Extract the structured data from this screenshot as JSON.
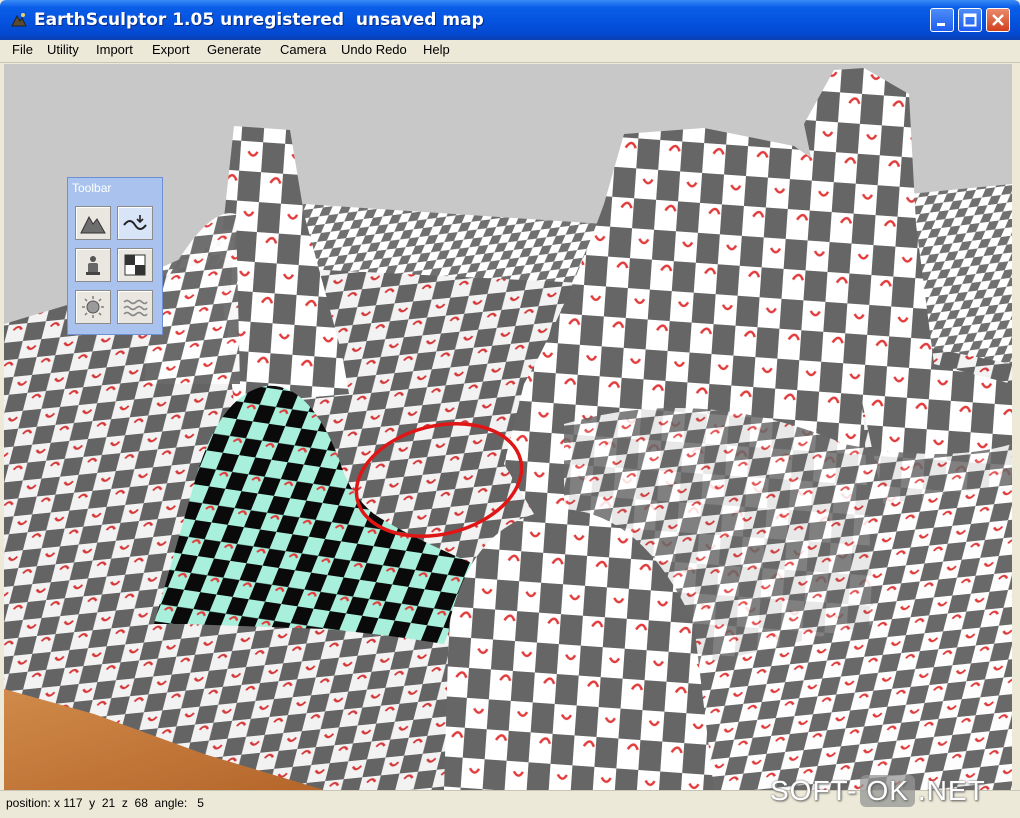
{
  "window": {
    "title": "EarthSculptor 1.05 unregistered  unsaved map",
    "app_icon": "earthsculptor-app-icon",
    "controls": [
      "minimize-icon",
      "maximize-icon",
      "close-icon"
    ]
  },
  "menu": {
    "items": [
      "File",
      "Utility",
      "Import",
      "Export",
      "Generate",
      "Camera",
      "Undo Redo",
      "Help"
    ]
  },
  "toolbar": {
    "title": "Toolbar",
    "tools": [
      "mountain-icon",
      "smooth-terrain-icon",
      "paint-figure-icon",
      "checker-texture-icon",
      "sun-icon",
      "water-icon"
    ]
  },
  "status": {
    "text": "position: x 117  y  21  z  68  angle:   5"
  },
  "watermark": {
    "left": "SOFT-",
    "ok": "OK",
    "right": ".NET"
  },
  "colors": {
    "titlebar": "#0554e0",
    "checker_dark": "#6a6a6a",
    "checker_light": "#ffffff",
    "accent_red": "#e23b3b",
    "selection_teal": "#a8f0dc",
    "ground_wood": "#c0773a"
  }
}
